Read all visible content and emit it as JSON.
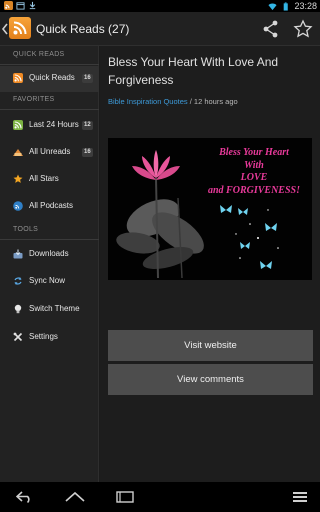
{
  "status_bar": {
    "time": "23:28",
    "left_icons": [
      "rss-notification-icon",
      "calendar-icon",
      "download-icon"
    ]
  },
  "action_bar": {
    "title": "Quick Reads (27)"
  },
  "sidebar": {
    "sections": {
      "quick_reads": "QUICK READS",
      "favorites": "FAVORITES",
      "tools": "TOOLS"
    },
    "items": [
      {
        "label": "Quick Reads",
        "badge": "16",
        "icon": "rss-icon"
      },
      {
        "label": "Last 24 Hours",
        "badge": "12",
        "icon": "rss-green-icon"
      },
      {
        "label": "All Unreads",
        "badge": "16",
        "icon": "unread-icon"
      },
      {
        "label": "All Stars",
        "badge": "",
        "icon": "star-icon"
      },
      {
        "label": "All Podcasts",
        "badge": "",
        "icon": "podcast-icon"
      },
      {
        "label": "Downloads",
        "badge": "",
        "icon": "download-icon"
      },
      {
        "label": "Sync Now",
        "badge": "",
        "icon": "sync-icon"
      },
      {
        "label": "Switch Theme",
        "badge": "",
        "icon": "lightbulb-icon"
      },
      {
        "label": "Settings",
        "badge": "",
        "icon": "settings-icon"
      }
    ]
  },
  "article": {
    "title": "Bless Your Heart With Love And Forgiveness",
    "source": "Bible Inspiration Quotes",
    "time_ago": "/ 12 hours ago",
    "image_text": [
      "Bless Your Heart",
      "With",
      "LOVE",
      "and FORGIVENESS!"
    ],
    "visit_label": "Visit website",
    "comments_label": "View comments"
  },
  "colors": {
    "accent": "#3d9ad8",
    "rss_orange": "#f08a24",
    "image_text": "#e83a9a"
  }
}
